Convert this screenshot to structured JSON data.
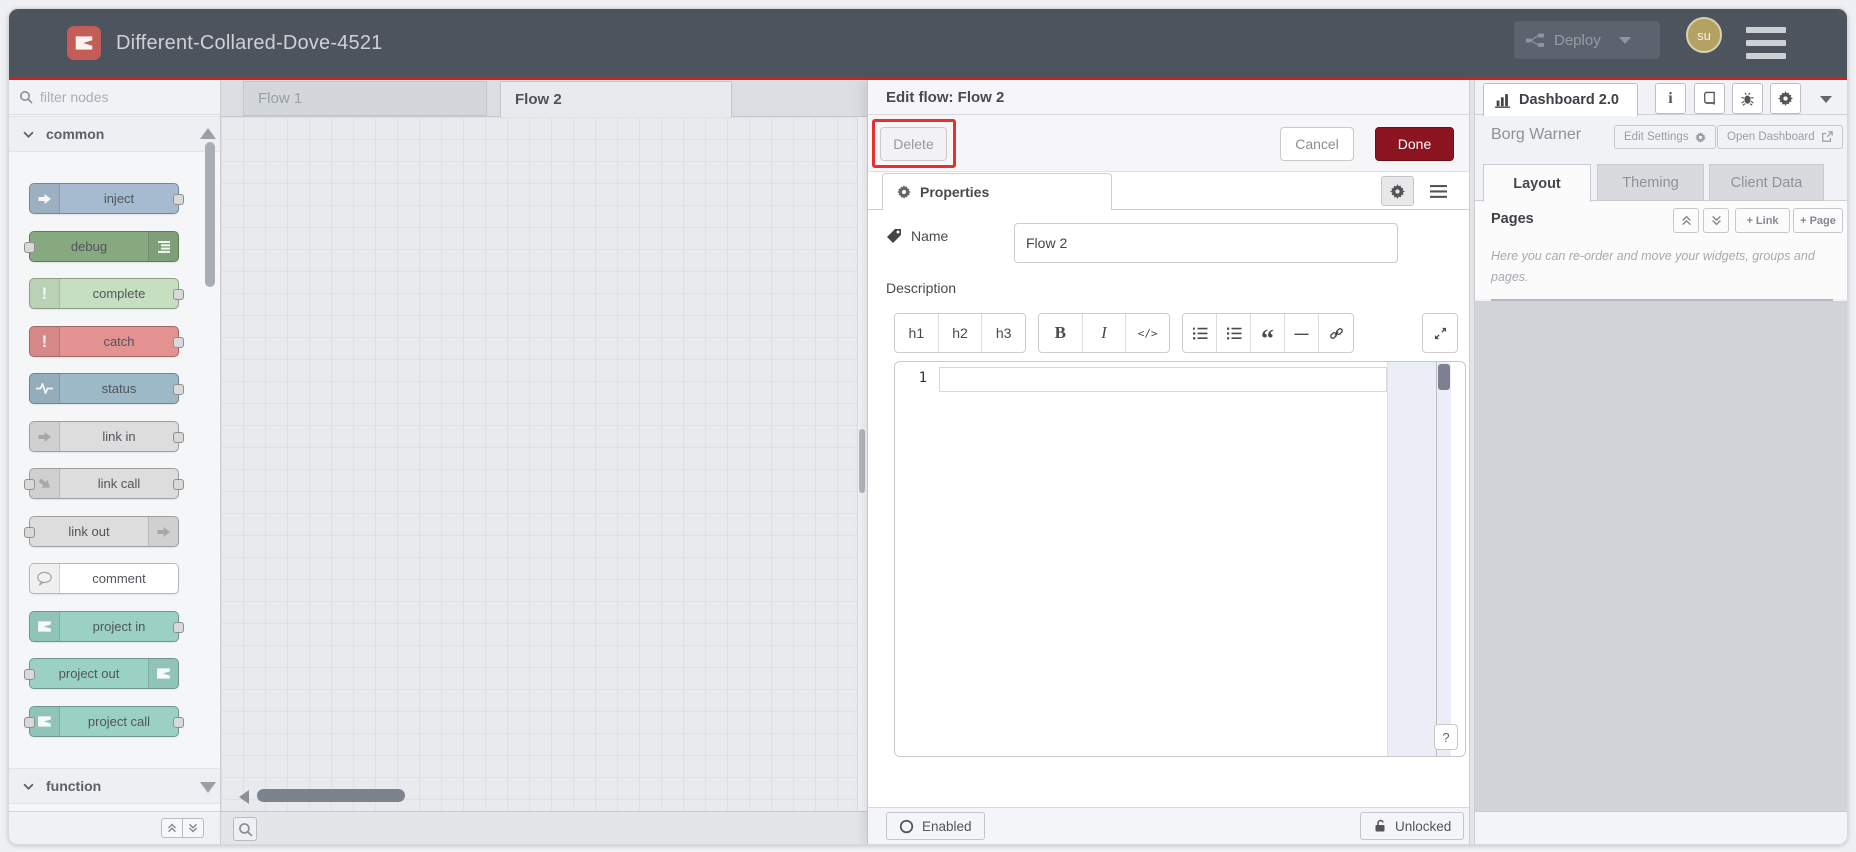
{
  "header": {
    "title": "Different-Collared-Dove-4521",
    "deploy_label": "Deploy",
    "avatar_initials": "su"
  },
  "palette": {
    "filter_placeholder": "filter nodes",
    "category_common": "common",
    "category_function": "function",
    "nodes": [
      {
        "label": "inject",
        "color": "#a6bbcf"
      },
      {
        "label": "debug",
        "color": "#87a980"
      },
      {
        "label": "complete",
        "color": "#c7dfc1"
      },
      {
        "label": "catch",
        "color": "#e49191"
      },
      {
        "label": "status",
        "color": "#9db8c6"
      },
      {
        "label": "link in",
        "color": "#dddddd"
      },
      {
        "label": "link call",
        "color": "#dddddd"
      },
      {
        "label": "link out",
        "color": "#dddddd"
      },
      {
        "label": "comment",
        "color": "#ffffff"
      },
      {
        "label": "project in",
        "color": "#9bd1c5"
      },
      {
        "label": "project out",
        "color": "#9bd1c5"
      },
      {
        "label": "project call",
        "color": "#9bd1c5"
      }
    ]
  },
  "workspace": {
    "tabs": [
      {
        "label": "Flow 1",
        "active": false
      },
      {
        "label": "Flow 2",
        "active": true
      }
    ]
  },
  "tray": {
    "title": "Edit flow: Flow 2",
    "delete_label": "Delete",
    "cancel_label": "Cancel",
    "done_label": "Done",
    "properties_tab": "Properties",
    "name_label": "Name",
    "name_value": "Flow 2",
    "description_label": "Description",
    "toolbar": {
      "h1": "h1",
      "h2": "h2",
      "h3": "h3",
      "bold": "B",
      "italic": "I",
      "code": "</>",
      "quote_glyph": "“",
      "hr_glyph": "—"
    },
    "editor_first_line_number": "1",
    "help_button": "?",
    "enabled_label": "Enabled",
    "unlocked_label": "Unlocked"
  },
  "sidebar": {
    "dashboard_tab": "Dashboard 2.0",
    "project_name": "Borg Warner",
    "edit_settings_label": "Edit Settings",
    "open_dashboard_label": "Open Dashboard",
    "tabs": [
      {
        "label": "Layout",
        "active": true
      },
      {
        "label": "Theming",
        "active": false
      },
      {
        "label": "Client Data",
        "active": false
      }
    ],
    "pages_title": "Pages",
    "add_link_label": "+ Link",
    "add_page_label": "+ Page",
    "pages_help_text": "Here you can re-order and move your widgets, groups and pages."
  },
  "glyphs": {
    "exclamation": "!",
    "info": "i"
  },
  "colors": {
    "header_bg": "#4e545d",
    "header_accent_line": "#d32121",
    "logo_red": "#c45c58",
    "avatar_bg": "#b3a264",
    "done_button": "#8c1420",
    "annotation_red": "#e53030",
    "canvas_bg": "#e9eaee",
    "grid_line": "#dfe0e6",
    "node_inject": "#a6bbcf",
    "node_debug": "#87a980",
    "node_complete": "#c7dfc1",
    "node_catch": "#e49191",
    "node_status": "#9db8c6",
    "node_link": "#dddddd",
    "node_comment": "#ffffff",
    "node_project": "#9bd1c5"
  }
}
